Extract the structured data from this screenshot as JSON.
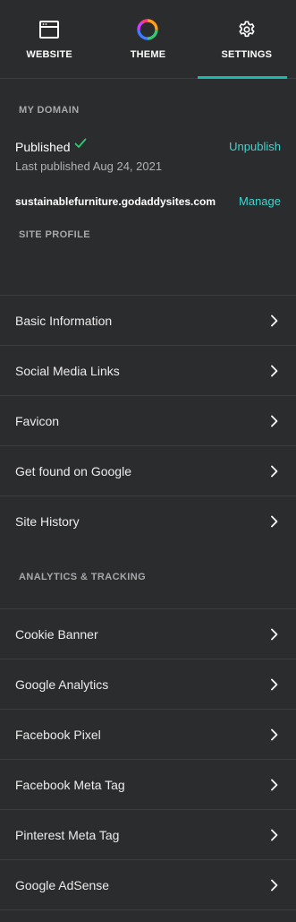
{
  "topnav": {
    "tabs": [
      {
        "label": "WEBSITE",
        "icon": "browser-window-icon",
        "active": false
      },
      {
        "label": "THEME",
        "icon": "color-wheel-icon",
        "active": true
      },
      {
        "label": "SETTINGS",
        "icon": "gear-icon",
        "active": true
      }
    ]
  },
  "my_domain": {
    "header": "MY DOMAIN",
    "status": "Published",
    "status_icon": "check-icon",
    "unpublish_label": "Unpublish",
    "last_published": "Last published Aug 24, 2021",
    "domain": "sustainablefurniture.godaddysites.com",
    "manage_label": "Manage"
  },
  "site_profile": {
    "header": "SITE PROFILE",
    "items": [
      {
        "label": "Basic Information"
      },
      {
        "label": "Social Media Links"
      },
      {
        "label": "Favicon"
      },
      {
        "label": "Get found on Google"
      },
      {
        "label": "Site History"
      }
    ]
  },
  "analytics": {
    "header": "ANALYTICS & TRACKING",
    "items": [
      {
        "label": "Cookie Banner"
      },
      {
        "label": "Google Analytics"
      },
      {
        "label": "Facebook Pixel"
      },
      {
        "label": "Facebook Meta Tag"
      },
      {
        "label": "Pinterest Meta Tag"
      },
      {
        "label": "Google AdSense"
      }
    ]
  },
  "colors": {
    "background": "#2b2c2e",
    "accent": "#1bb7b0",
    "link": "#3fd6d0",
    "check": "#2ecc71",
    "divider": "#3c3d40"
  }
}
